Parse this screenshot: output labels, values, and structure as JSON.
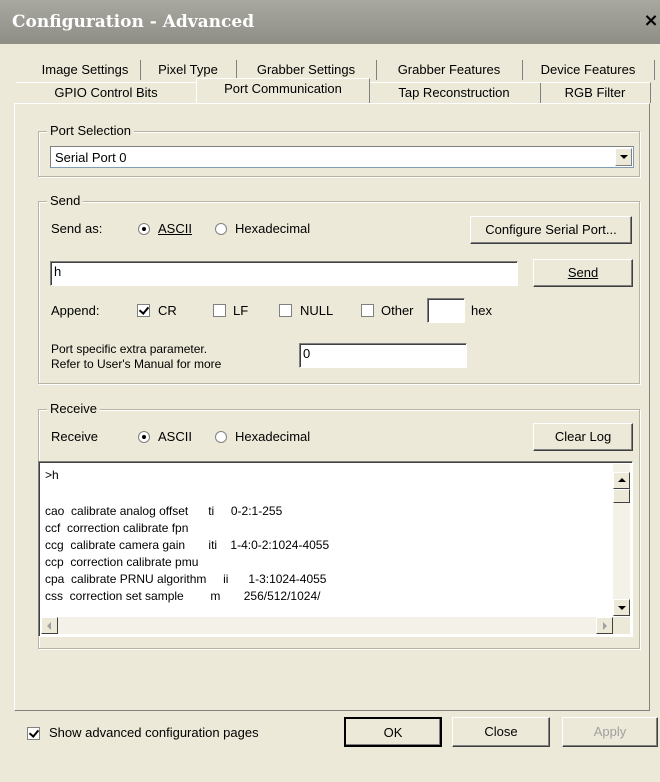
{
  "window": {
    "title": "Configuration - Advanced",
    "close_label": "×"
  },
  "tabs": {
    "row1": [
      "Image Settings",
      "Pixel Type",
      "Grabber Settings",
      "Grabber Features",
      "Device Features"
    ],
    "row2": [
      "GPIO Control Bits",
      "Port Communication",
      "Tap Reconstruction",
      "RGB Filter"
    ],
    "active": "Port Communication"
  },
  "port_selection": {
    "legend": "Port Selection",
    "selected": "Serial Port 0"
  },
  "send": {
    "legend": "Send",
    "send_as_label": "Send as:",
    "ascii_label": "ASCII",
    "hex_label": "Hexadecimal",
    "mode": "ASCII",
    "configure_button": "Configure Serial Port...",
    "input_value": "h",
    "send_button": "Send",
    "append_label": "Append:",
    "cr_label": "CR",
    "cr_checked": true,
    "lf_label": "LF",
    "lf_checked": false,
    "null_label": "NULL",
    "null_checked": false,
    "other_label": "Other",
    "other_checked": false,
    "other_value": "",
    "hex_suffix": "hex",
    "extra_param_line1": "Port specific extra parameter.",
    "extra_param_line2": "Refer to User's Manual for more",
    "extra_param_value": "0"
  },
  "receive": {
    "legend": "Receive",
    "receive_label": "Receive",
    "ascii_label": "ASCII",
    "hex_label": "Hexadecimal",
    "mode": "ASCII",
    "clear_button": "Clear Log",
    "log_lines": [
      ">h",
      "",
      "cao  calibrate analog offset      ti     0-2:1-255",
      "ccf  correction calibrate fpn",
      "ccg  calibrate camera gain       iti    1-4:0-2:1024-4055",
      "ccp  correction calibrate pmu",
      "cpa  calibrate PRNU algorithm     ii      1-3:1024-4055",
      "css  correction set sample        m       256/512/1024/"
    ]
  },
  "footer": {
    "show_advanced_label": "Show advanced configuration pages",
    "show_advanced_checked": true,
    "ok_button": "OK",
    "close_button": "Close",
    "apply_button": "Apply"
  }
}
